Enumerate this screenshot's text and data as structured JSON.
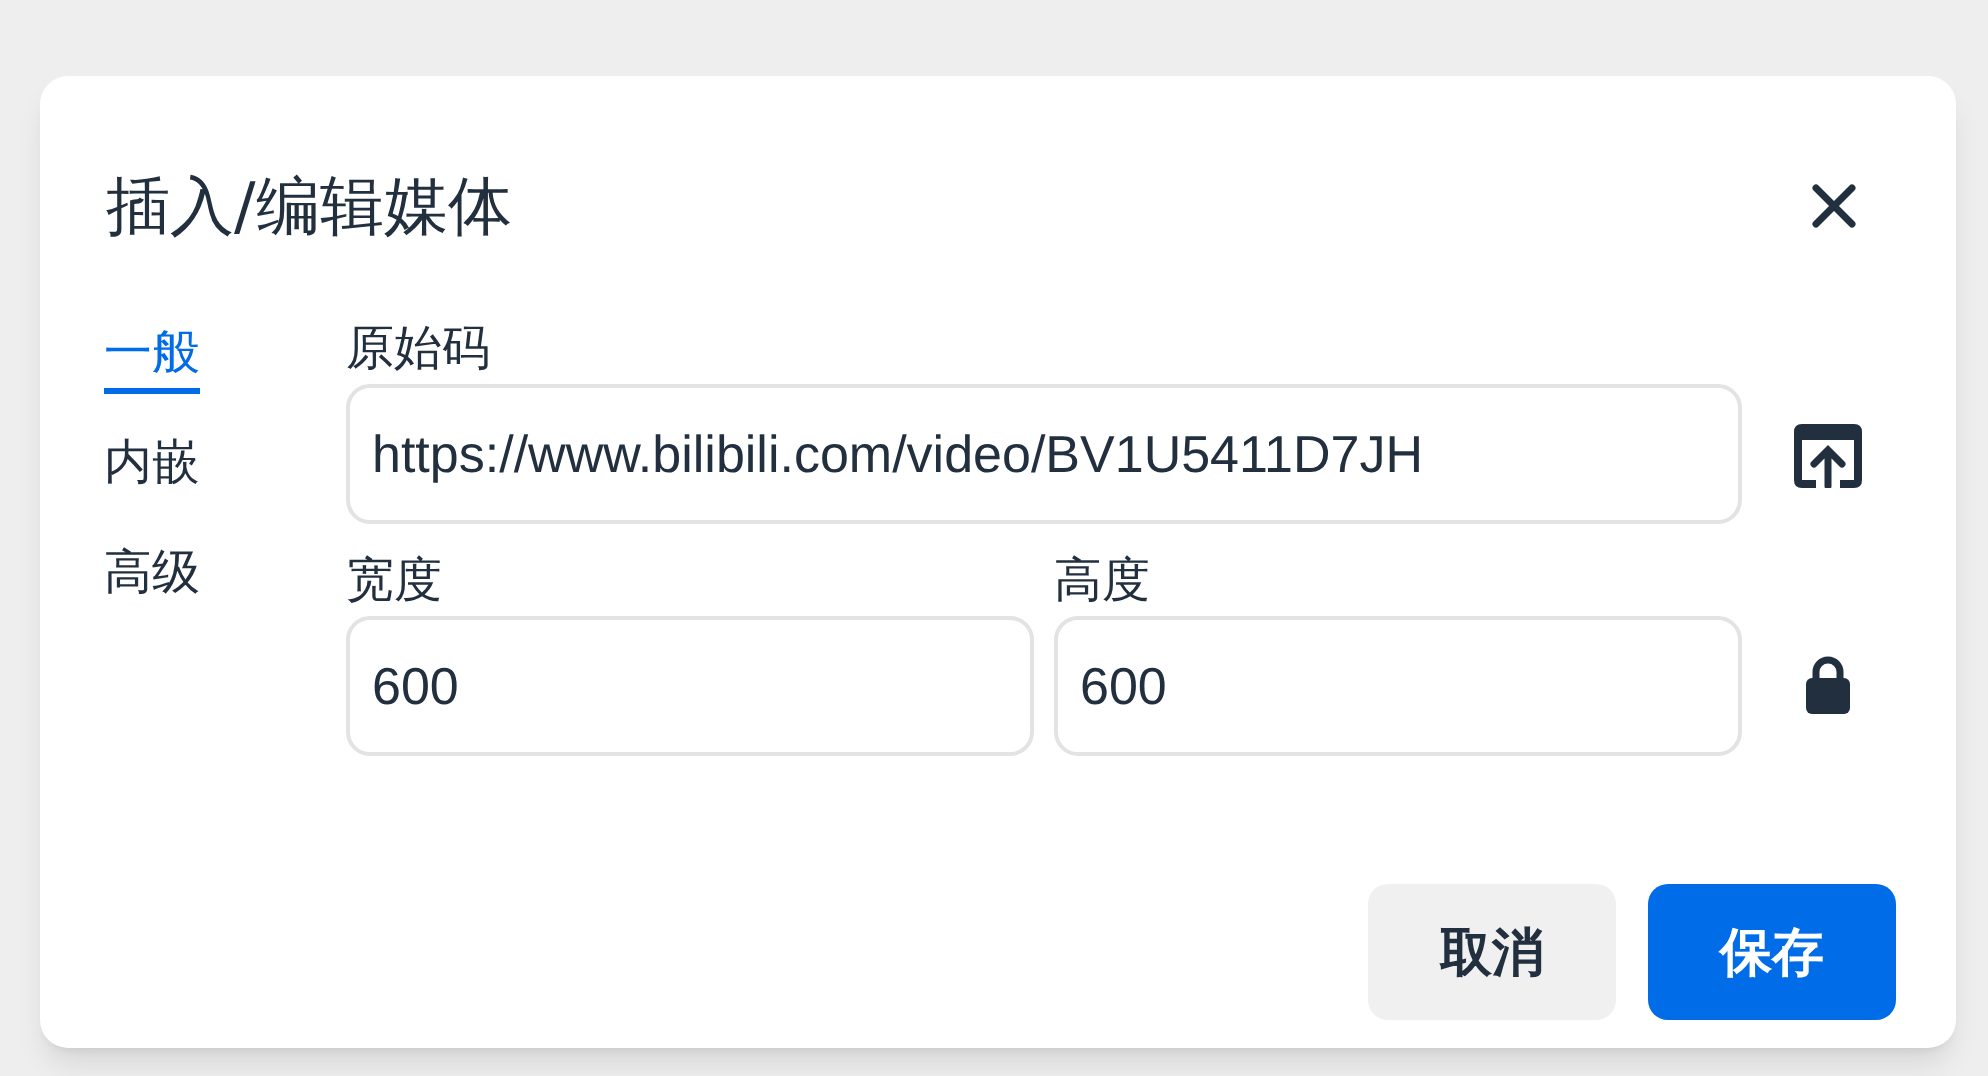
{
  "dialog": {
    "title": "插入/编辑媒体"
  },
  "tabs": [
    {
      "label": "一般",
      "selected": true
    },
    {
      "label": "内嵌",
      "selected": false
    },
    {
      "label": "高级",
      "selected": false
    }
  ],
  "source": {
    "label": "原始码",
    "value": "https://www.bilibili.com/video/BV1U5411D7JH"
  },
  "width": {
    "label": "宽度",
    "value": "600"
  },
  "height": {
    "label": "高度",
    "value": "600"
  },
  "buttons": [
    {
      "label": "取消",
      "kind": "secondary"
    },
    {
      "label": "保存",
      "kind": "primary"
    }
  ]
}
